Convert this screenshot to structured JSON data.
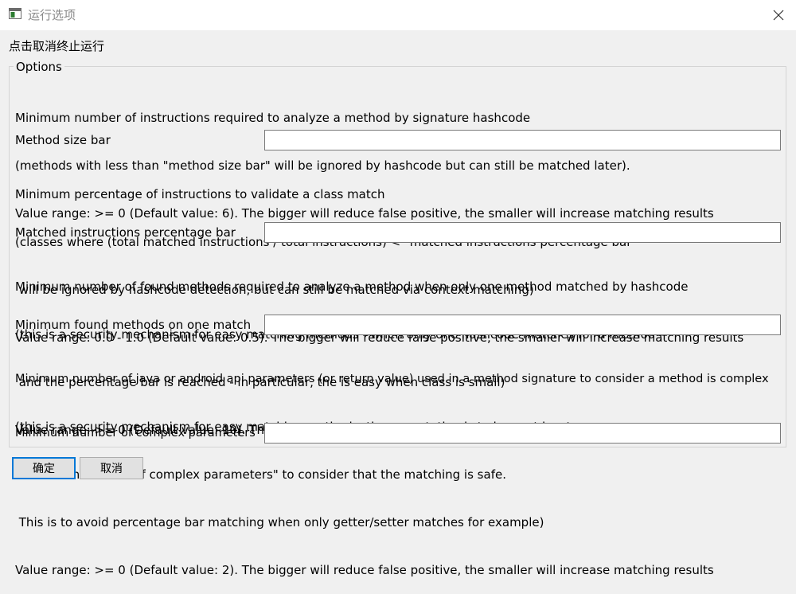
{
  "window": {
    "title": "运行选项",
    "app_icon": "window-app-icon",
    "close_icon": "close-icon"
  },
  "hint": "点击取消终止运行",
  "options": {
    "legend": "Options",
    "fields": [
      {
        "description": [
          "Minimum number of instructions required to analyze a method by signature hashcode",
          "(methods with less than \"method size bar\" will be ignored by hashcode but can still be matched later).",
          "Value range: >= 0 (Default value: 6). The bigger will reduce false positive, the smaller will increase matching results"
        ],
        "label": "Method size bar",
        "value": ""
      },
      {
        "description": [
          "Minimum percentage of instructions to validate a class match",
          "(classes where (total matched instructions / total instructions) < \"matched instructions percentage bar\"",
          " will be ignored by hashcode detection, but can still be matched via context matching)",
          "Value range: 0.0 - 1.0 (Default value: 0.5). The bigger will reduce false positive, the smaller will increase matching results"
        ],
        "label": "Matched instructions percentage bar",
        "value": ""
      },
      {
        "description": [
          "Minimum number of found methods required to analyze a method when only one method matched by hashcode",
          "(this is a security mechanism for easy matching methods - when only one hashcode matches for a method -",
          " and the percentage bar is reached - in particular, the is easy when class is small)",
          "Value range: >= 0 (Default value: 10). The bigger will reduce false positive, the smaller will increase matching results"
        ],
        "label": "Minimum found methods on one match",
        "value": ""
      },
      {
        "description": [
          "Minimum number of java or android api parameters (or return value) used in a method signature to consider a method is complex",
          "(this is a security mechanism for easy matching methods: the expectation is to have at least",
          " \"Minimum number of complex parameters\" to consider that the matching is safe.",
          " This is to avoid percentage bar matching when only getter/setter matches for example)",
          "Value range: >= 0 (Default value: 2). The bigger will reduce false positive, the smaller will increase matching results"
        ],
        "label": "Minimum number of complex parameters",
        "value": ""
      }
    ]
  },
  "buttons": {
    "ok": "确定",
    "cancel": "取消"
  },
  "colors": {
    "background": "#f0f0f0",
    "titlebar": "#ffffff",
    "default_button_border": "#0078d7"
  }
}
